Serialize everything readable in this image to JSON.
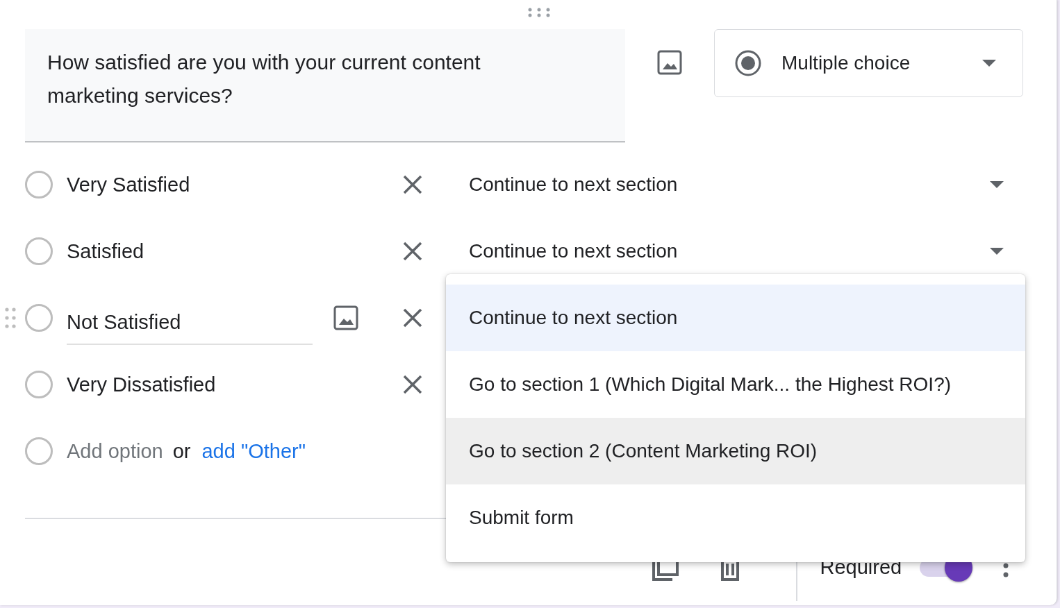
{
  "question": {
    "text": "How satisfied are you with your current content marketing services?"
  },
  "question_type": {
    "label": "Multiple choice"
  },
  "options": [
    {
      "label": "Very Satisfied",
      "focused": false,
      "section": "Continue to next section"
    },
    {
      "label": "Satisfied",
      "focused": false,
      "section": "Continue to next section"
    },
    {
      "label": "Not Satisfied",
      "focused": true
    },
    {
      "label": "Very Dissatisfied",
      "focused": false
    }
  ],
  "add_option": {
    "placeholder": "Add option",
    "separator": "or",
    "link": "add \"Other\""
  },
  "section_menu": {
    "items": [
      {
        "label": "Continue to next section",
        "selected": true,
        "hovered": false
      },
      {
        "label": "Go to section 1 (Which Digital Mark... the Highest ROI?)",
        "selected": false,
        "hovered": false
      },
      {
        "label": "Go to section 2 (Content Marketing ROI)",
        "selected": false,
        "hovered": true
      },
      {
        "label": "Submit form",
        "selected": false,
        "hovered": false
      }
    ]
  },
  "footer": {
    "required_label": "Required",
    "required": true
  }
}
